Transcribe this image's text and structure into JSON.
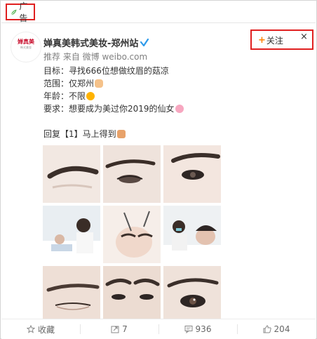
{
  "ad": {
    "label": "广告",
    "icon": "leaf-icon"
  },
  "post": {
    "author": "婵真美韩式美妆-郑州站",
    "verified": true,
    "meta": "推荐 来自 微博 weibo.com",
    "logo": {
      "name": "婵真美",
      "sub": "韩式美妆"
    },
    "lines": [
      "目标：寻找666位想做纹眉的菇凉",
      "范围：仅郑州",
      "年龄：不限",
      "要求：想要成为美过你2019的仙女",
      "",
      "回复【1】马上得到"
    ]
  },
  "follow": {
    "plus": "+",
    "label": "关注",
    "close": "×"
  },
  "photos": [
    "brow-closeup-1",
    "eye-brow-2",
    "eye-brow-3",
    "procedure-1",
    "procedure-2",
    "procedure-3",
    "brow-closeup-4",
    "brow-closeup-5",
    "eye-closeup-6"
  ],
  "actions": [
    {
      "label": "收藏",
      "icon": "star-icon"
    },
    {
      "label": "7",
      "icon": "repost-icon"
    },
    {
      "label": "936",
      "icon": "comment-icon"
    },
    {
      "label": "204",
      "icon": "like-icon"
    }
  ],
  "colors": {
    "highlight": "#e02020",
    "accent": "#ff8200",
    "text": "#333333",
    "muted": "#808080"
  }
}
